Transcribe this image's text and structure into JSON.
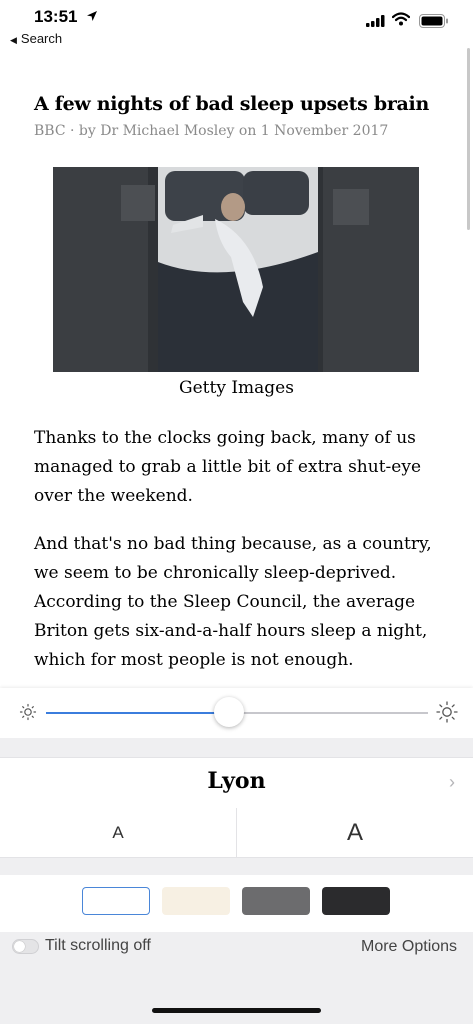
{
  "status": {
    "time": "13:51",
    "back_label": "Search"
  },
  "article": {
    "headline": "A few nights of bad sleep upsets brain",
    "byline": "BBC · by Dr Michael Mosley on 1 November 2017",
    "image_caption": "Getty Images",
    "paragraphs": [
      "Thanks to the clocks going back, many of us managed to grab a little bit of extra shut-eye over the weekend.",
      "And that's no bad thing because, as a country, we seem to be chronically sleep-deprived. According to the Sleep Council, the average Briton gets six-and-a-half hours sleep a night, which for most people is not enough."
    ]
  },
  "reader_settings": {
    "brightness": 0.48,
    "font_name": "Lyon",
    "size_decrease_label": "A",
    "size_increase_label": "A",
    "themes": [
      {
        "name": "white",
        "color": "#ffffff",
        "selected": true
      },
      {
        "name": "sepia",
        "color": "#f7f0e3",
        "selected": false
      },
      {
        "name": "gray",
        "color": "#6c6c6e",
        "selected": false
      },
      {
        "name": "black",
        "color": "#2b2b2d",
        "selected": false
      }
    ],
    "tilt_label": "Tilt scrolling off",
    "tilt_enabled": false,
    "more_options_label": "More Options"
  },
  "colors": {
    "accent": "#3b7ddd"
  }
}
